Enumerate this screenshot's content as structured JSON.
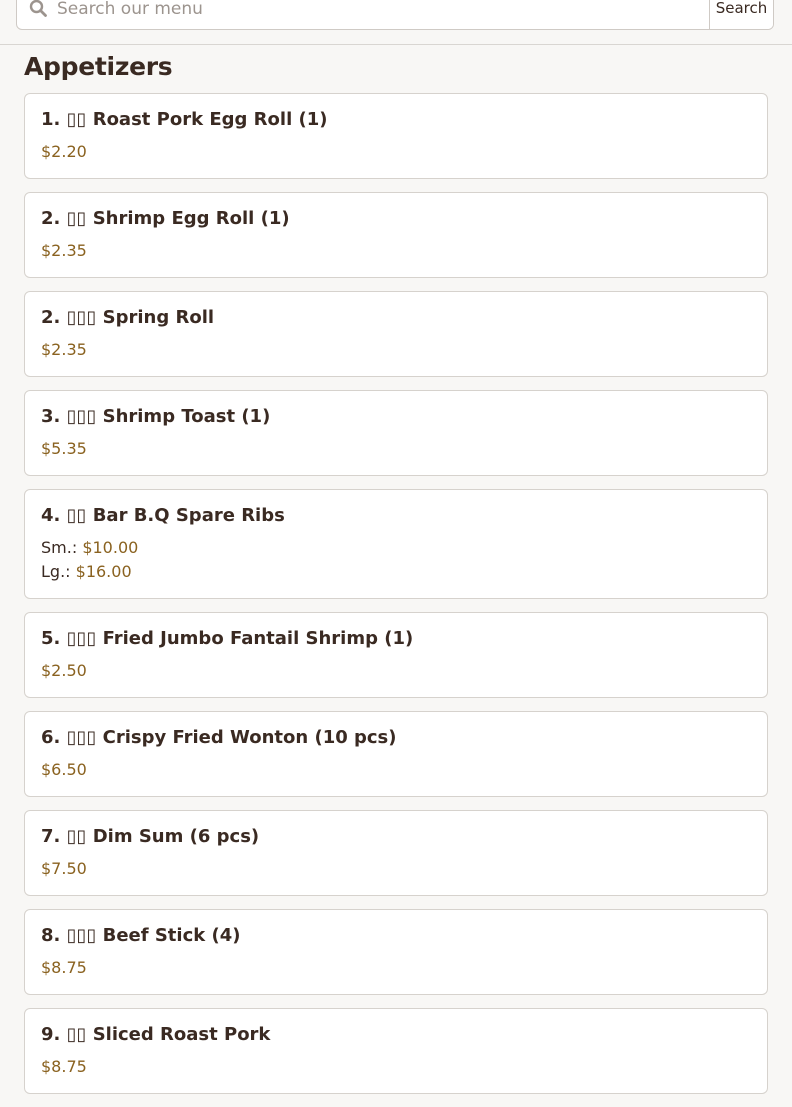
{
  "search": {
    "placeholder": "Search our menu",
    "button_label": "Search"
  },
  "section": {
    "title": "Appetizers"
  },
  "items": [
    {
      "title": "1. ▯▯ Roast Pork Egg Roll (1)",
      "prices": [
        {
          "label": "",
          "value": "$2.20"
        }
      ]
    },
    {
      "title": "2. ▯▯ Shrimp Egg Roll (1)",
      "prices": [
        {
          "label": "",
          "value": "$2.35"
        }
      ]
    },
    {
      "title": "2. ▯▯▯ Spring Roll",
      "prices": [
        {
          "label": "",
          "value": "$2.35"
        }
      ]
    },
    {
      "title": "3. ▯▯▯ Shrimp Toast (1)",
      "prices": [
        {
          "label": "",
          "value": "$5.35"
        }
      ]
    },
    {
      "title": "4. ▯▯ Bar B.Q Spare Ribs",
      "prices": [
        {
          "label": "Sm.:",
          "value": "$10.00"
        },
        {
          "label": "Lg.:",
          "value": "$16.00"
        }
      ]
    },
    {
      "title": "5. ▯▯▯ Fried Jumbo Fantail Shrimp (1)",
      "prices": [
        {
          "label": "",
          "value": "$2.50"
        }
      ]
    },
    {
      "title": "6. ▯▯▯ Crispy Fried Wonton (10 pcs)",
      "prices": [
        {
          "label": "",
          "value": "$6.50"
        }
      ]
    },
    {
      "title": "7. ▯▯ Dim Sum (6 pcs)",
      "prices": [
        {
          "label": "",
          "value": "$7.50"
        }
      ]
    },
    {
      "title": "8. ▯▯▯ Beef Stick (4)",
      "prices": [
        {
          "label": "",
          "value": "$8.75"
        }
      ]
    },
    {
      "title": "9. ▯▯ Sliced Roast Pork",
      "prices": [
        {
          "label": "",
          "value": "$8.75"
        }
      ]
    }
  ],
  "colors": {
    "accent_price": "#8a6220",
    "text": "#3a2a22",
    "card_border": "#d6d2cd",
    "background": "#f8f7f5"
  }
}
